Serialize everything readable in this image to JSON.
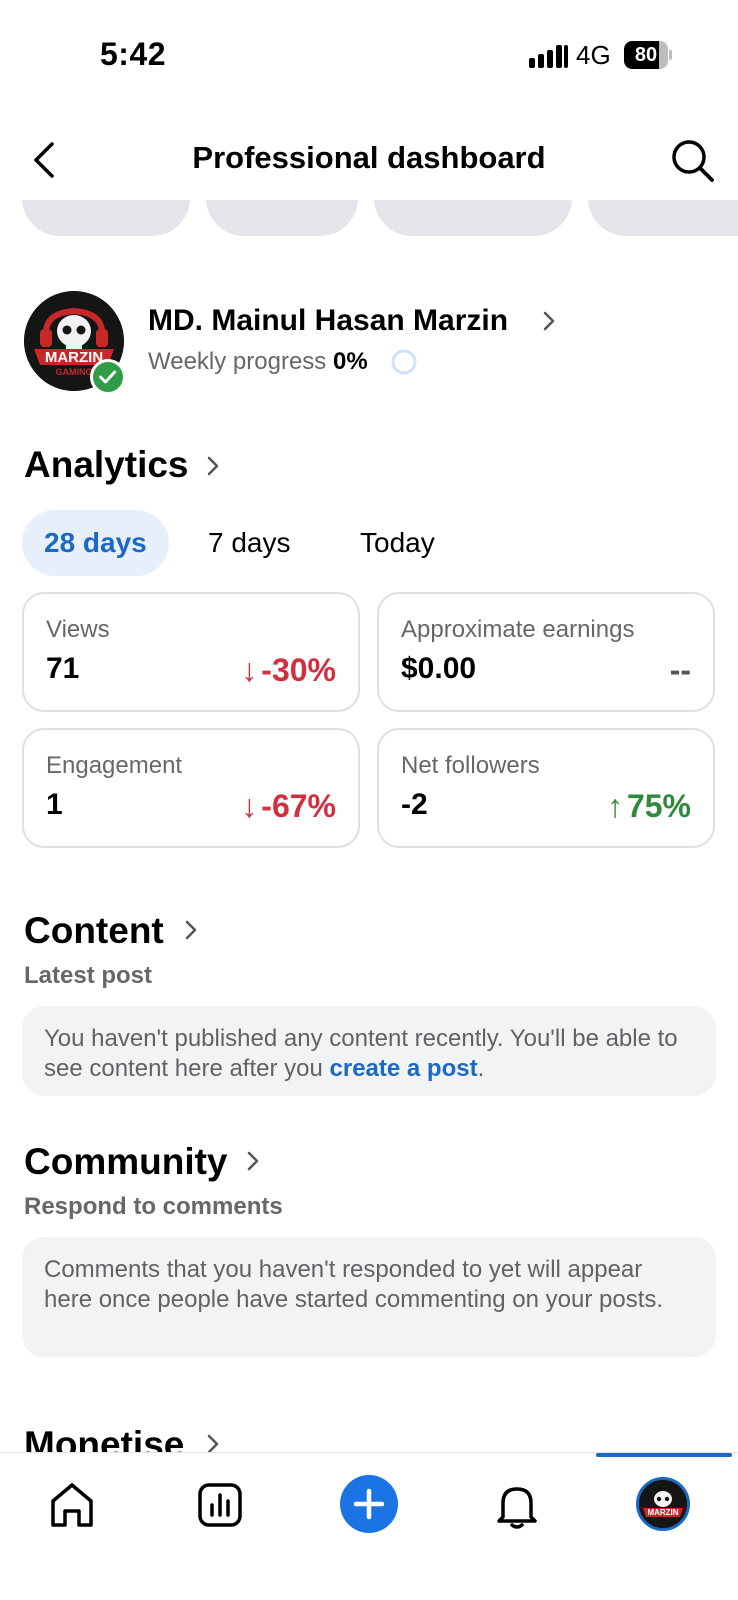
{
  "status_bar": {
    "time": "5:42",
    "network": "4G",
    "battery": "80",
    "battery_level": 0.8
  },
  "header": {
    "title": "Professional dashboard"
  },
  "profile": {
    "name": "MD. Mainul Hasan Marzin",
    "weekly_label": "Weekly progress",
    "weekly_value": "0%",
    "avatar_text": "MARZIN",
    "avatar_subtext": "GAMING"
  },
  "analytics": {
    "title": "Analytics",
    "tabs": [
      {
        "label": "28 days",
        "active": true
      },
      {
        "label": "7 days",
        "active": false
      },
      {
        "label": "Today",
        "active": false
      }
    ],
    "metrics": [
      {
        "label": "Views",
        "value": "71",
        "arrow": "↓",
        "change": "-30%",
        "trend": "down"
      },
      {
        "label": "Approximate earnings",
        "value": "$0.00",
        "arrow": "",
        "change": "--",
        "trend": "neutral"
      },
      {
        "label": "Engagement",
        "value": "1",
        "arrow": "↓",
        "change": "-67%",
        "trend": "down"
      },
      {
        "label": "Net followers",
        "value": "-2",
        "arrow": "↑",
        "change": "75%",
        "trend": "up"
      }
    ]
  },
  "content": {
    "title": "Content",
    "subtitle": "Latest post",
    "message": "You haven't published any content recently. You'll be able to see content here after you ",
    "link": "create a post",
    "message_end": "."
  },
  "community": {
    "title": "Community",
    "subtitle": "Respond to comments",
    "message": "Comments that you haven't responded to yet will appear here once people have started commenting on your posts."
  },
  "monetise": {
    "title": "Monetise"
  },
  "nav": {
    "avatar_text": "MARZIN"
  },
  "colors": {
    "accent": "#1a69c5",
    "down": "#d1303f",
    "up": "#2e8a3c",
    "create": "#1b74e4"
  }
}
